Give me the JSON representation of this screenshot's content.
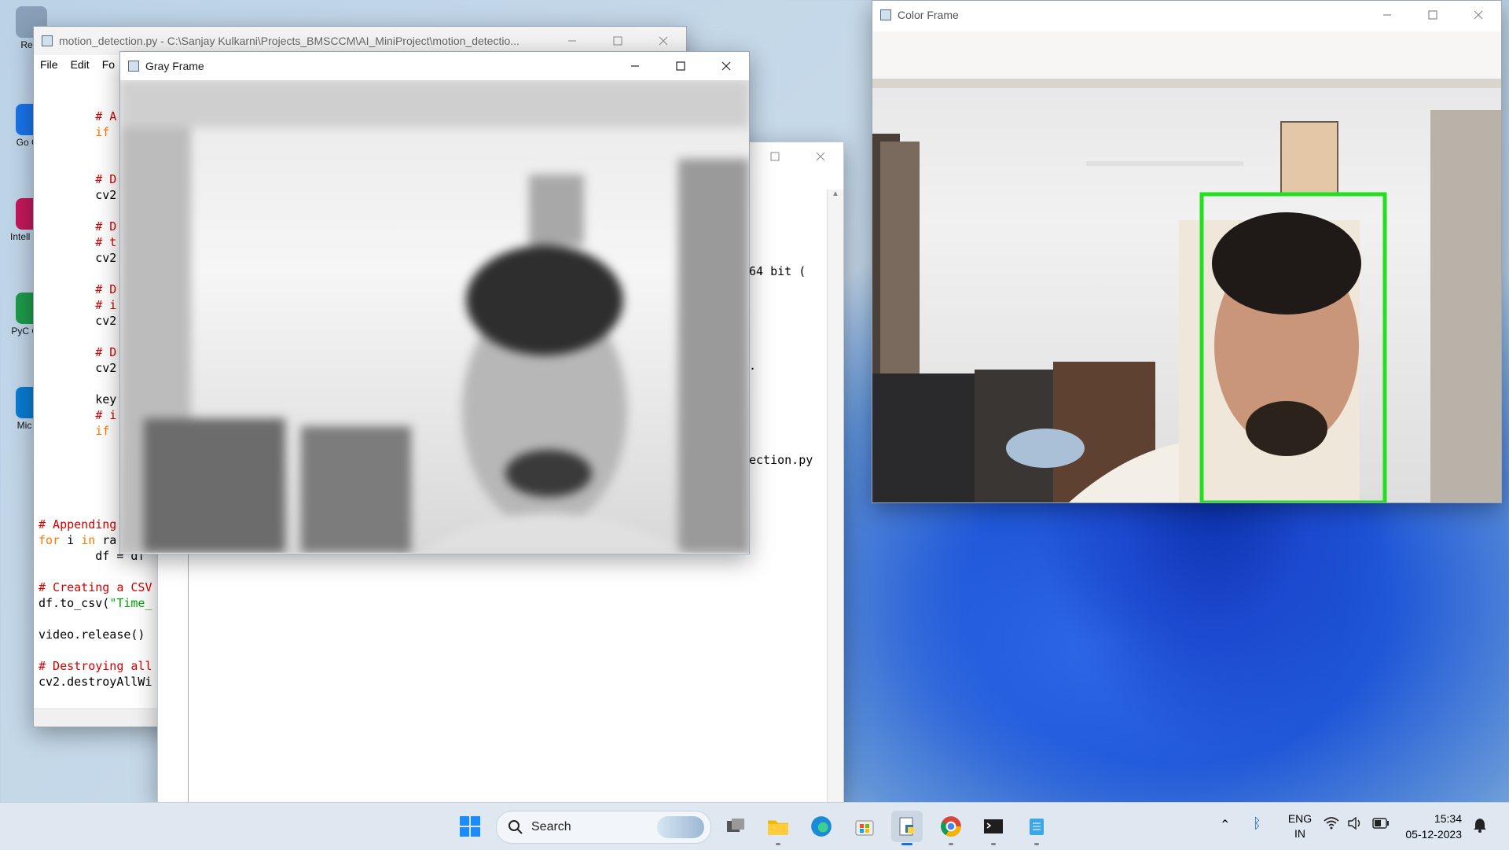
{
  "desktop": {
    "icons": [
      {
        "label": "Recy",
        "color": "#8aa0b8"
      },
      {
        "label": "Go Chr",
        "color": "#1a73e8"
      },
      {
        "label": "Intell Com",
        "color": "#c2185b"
      },
      {
        "label": "PyC Com",
        "color": "#1e9a4a"
      },
      {
        "label": "Mic Ed",
        "color": "#0a7bd0"
      }
    ]
  },
  "editor_window": {
    "title": "motion_detection.py - C:\\Sanjay Kulkarni\\Projects_BMSCCM\\AI_MiniProject\\motion_detectio...",
    "menu": [
      "File",
      "Edit",
      "Fo"
    ],
    "code_top": [
      {
        "indent": "        ",
        "text": "# A",
        "kind": "cm"
      },
      {
        "indent": "        ",
        "text": "if",
        "kind": "kw"
      },
      {
        "indent": "",
        "text": "",
        "kind": "plain"
      },
      {
        "indent": "",
        "text": "",
        "kind": "plain"
      },
      {
        "indent": "        ",
        "text": "# D",
        "kind": "cm"
      },
      {
        "indent": "        ",
        "text": "cv2",
        "kind": "plain"
      },
      {
        "indent": "",
        "text": "",
        "kind": "plain"
      },
      {
        "indent": "        ",
        "text": "# D",
        "kind": "cm"
      },
      {
        "indent": "        ",
        "text": "# t",
        "kind": "cm"
      },
      {
        "indent": "        ",
        "text": "cv2",
        "kind": "plain"
      },
      {
        "indent": "",
        "text": "",
        "kind": "plain"
      },
      {
        "indent": "        ",
        "text": "# D",
        "kind": "cm"
      },
      {
        "indent": "        ",
        "text": "# i",
        "kind": "cm"
      },
      {
        "indent": "        ",
        "text": "cv2",
        "kind": "plain"
      },
      {
        "indent": "",
        "text": "",
        "kind": "plain"
      },
      {
        "indent": "        ",
        "text": "# D",
        "kind": "cm"
      },
      {
        "indent": "        ",
        "text": "cv2",
        "kind": "plain"
      },
      {
        "indent": "",
        "text": "",
        "kind": "plain"
      },
      {
        "indent": "        ",
        "text": "key",
        "kind": "plain"
      },
      {
        "indent": "        ",
        "text": "# i",
        "kind": "cm"
      },
      {
        "indent": "        ",
        "text": "if",
        "kind": "kw"
      }
    ],
    "code_bottom": [
      {
        "parts": [
          {
            "t": "# Appending",
            "k": "cm"
          }
        ]
      },
      {
        "parts": [
          {
            "t": "for",
            "k": "kw"
          },
          {
            "t": " i ",
            "k": "plain"
          },
          {
            "t": "in",
            "k": "kw"
          },
          {
            "t": " ra",
            "k": "plain"
          }
        ]
      },
      {
        "parts": [
          {
            "t": "        df = df",
            "k": "plain"
          }
        ]
      },
      {
        "parts": [
          {
            "t": "",
            "k": "plain"
          }
        ]
      },
      {
        "parts": [
          {
            "t": "# Creating a CSV",
            "k": "cm"
          }
        ]
      },
      {
        "parts": [
          {
            "t": "df.to_csv(",
            "k": "plain"
          },
          {
            "t": "\"Time_",
            "k": "str"
          }
        ]
      },
      {
        "parts": [
          {
            "t": "",
            "k": "plain"
          }
        ]
      },
      {
        "parts": [
          {
            "t": "video.release()",
            "k": "plain"
          }
        ]
      },
      {
        "parts": [
          {
            "t": "",
            "k": "plain"
          }
        ]
      },
      {
        "parts": [
          {
            "t": "# Destroying all",
            "k": "cm"
          }
        ]
      },
      {
        "parts": [
          {
            "t": "cv2.destroyAllWi",
            "k": "plain"
          }
        ]
      }
    ]
  },
  "shell_window": {
    "lines": [
      "64 bit (",
      ".",
      "ection.py"
    ]
  },
  "gray_frame": {
    "title": "Gray Frame"
  },
  "color_frame": {
    "title": "Color Frame",
    "box_color": "#22e01e"
  },
  "taskbar": {
    "search_placeholder": "Search",
    "apps": [
      "windows-start",
      "task-view",
      "file-explorer",
      "edge",
      "store",
      "python-idle",
      "chrome",
      "terminal",
      "notepad"
    ],
    "tray": {
      "lang_line1": "ENG",
      "lang_line2": "IN",
      "time": "15:34",
      "date": "05-12-2023"
    }
  }
}
